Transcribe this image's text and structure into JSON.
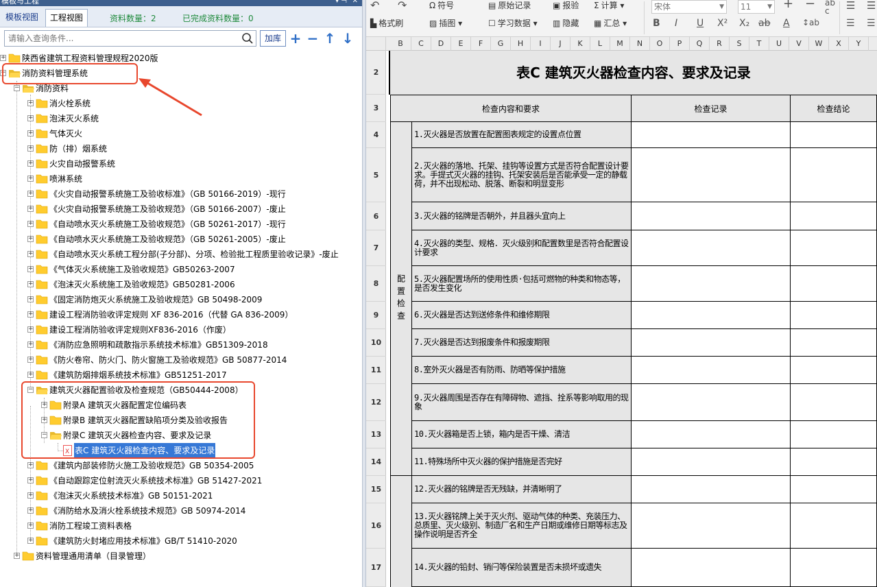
{
  "left_panel": {
    "title": "模板与工程",
    "tabs": [
      "模板视图",
      "工程视图"
    ],
    "count_label": "资料数量：2",
    "done_label": "已完成资料数量：0",
    "search_placeholder": "请输入查询条件...",
    "jiaku_label": "加库",
    "tree": [
      {
        "label": "陕西省建筑工程资料管理规程2020版"
      },
      {
        "label": "消防资料管理系统"
      },
      {
        "label": "消防资料"
      },
      {
        "label": "消火栓系统"
      },
      {
        "label": "泡沫灭火系统"
      },
      {
        "label": "气体灭火"
      },
      {
        "label": "防（排）烟系统"
      },
      {
        "label": "火灾自动报警系统"
      },
      {
        "label": "喷淋系统"
      },
      {
        "label": "《火灾自动报警系统施工及验收标准》（GB 50166-2019）-现行"
      },
      {
        "label": "《火灾自动报警系统施工及验收规范》（GB 50166-2007）-废止"
      },
      {
        "label": "《自动喷水灭火系统施工及验收规范》（GB 50261-2017）-现行"
      },
      {
        "label": "《自动喷水灭火系统施工及验收规范》（GB 50261-2005）-废止"
      },
      {
        "label": "《自动喷水灭火系统工程分部(子分部)、分项、检验批工程质里验收记录》-废止"
      },
      {
        "label": "《气体灭火系统施工及验收规范》GB50263-2007"
      },
      {
        "label": "《泡沫灭火系统施工及验收规范》GB50281-2006"
      },
      {
        "label": "《固定消防炮灭火系统施工及验收规范》GB 50498-2009"
      },
      {
        "label": "建设工程消防验收评定规则 XF 836-2016（代替 GA 836-2009）"
      },
      {
        "label": "建设工程消防验收评定规则XF836-2016（作废）"
      },
      {
        "label": "《消防应急照明和疏散指示系统技术标准》GB51309-2018"
      },
      {
        "label": "《防火卷帘、防火门、防火窗施工及验收规范》GB 50877-2014"
      },
      {
        "label": "《建筑防烟排烟系统技术标准》GB51251-2017"
      },
      {
        "label": "建筑灭火器配置验收及检查规范（GB50444-2008）"
      },
      {
        "label": "附录A 建筑灭火器配置定位编码表"
      },
      {
        "label": "附录B 建筑灭火器配置缺陷项分类及验收报告"
      },
      {
        "label": "附录C 建筑灭火器检查内容、要求及记录"
      },
      {
        "label": "表C 建筑灭火器检查内容、要求及记录"
      },
      {
        "label": "《建筑内部装修防火施工及验收规范》GB 50354-2005"
      },
      {
        "label": "《自动跟踪定位射流灭火系统技术标准》GB 51427-2021"
      },
      {
        "label": "《泡沫灭火系统技术标准》GB 50151-2021"
      },
      {
        "label": "《消防给水及消火栓系统技术规范》GB 50974-2014"
      },
      {
        "label": "消防工程竣工资料表格"
      },
      {
        "label": "《建筑防火封堵应用技术标准》GB/T 51410-2020"
      },
      {
        "label": "资料管理通用清单（目录管理）"
      }
    ]
  },
  "ribbon": {
    "symbol": "符号",
    "original_record": "原始记录",
    "report": "报验",
    "calc": "计算",
    "font_name": "宋体",
    "font_size": "11",
    "format_painter": "格式刷",
    "insert_image": "插图",
    "learn_data": "学习数据",
    "hide": "隐藏",
    "summary": "汇总"
  },
  "columns": [
    "B",
    "C",
    "D",
    "E",
    "F",
    "G",
    "H",
    "I",
    "J",
    "K",
    "L",
    "M",
    "N",
    "O",
    "P",
    "Q",
    "R",
    "S",
    "T",
    "U",
    "V",
    "W",
    "X",
    "Y"
  ],
  "rows": [
    "2",
    "3",
    "4",
    "5",
    "6",
    "7",
    "8",
    "9",
    "10",
    "11",
    "12",
    "13",
    "14",
    "15",
    "16",
    "17"
  ],
  "sheet": {
    "title": "表C  建筑灭火器检查内容、要求及记录",
    "header_content": "检查内容和要求",
    "header_record": "检查记录",
    "header_conclusion": "检查结论",
    "group1_label": "配置检查",
    "items": [
      "1.灭火器是否放置在配置图表规定的设置点位置",
      "2.灭火器的落地、托架、挂钩等设置方式是否符合配置设计要求。手提式灭火器的挂钩、托架安装后是否能承受一定的静载荷，并不出现松动、脱落、断裂和明显变形",
      "3.灭火器的铭牌是否朝外，并且器头宜向上",
      "4.灭火器的类型、规格．灭火级别和配置数里是否符合配置设计要求",
      "5.灭火器配置场所的使用性质·包括可燃物的种类和物态等，是否发生变化",
      "6.灭火器是否达到送修条件和维修期限",
      "7.灭火器是否达到报废条件和报废期限",
      "8.室外灭火器是否有防雨、防晒等保护措施",
      "9.灭火器周围是否存在有障碍物、遮挡、拴系等影响取用的现象",
      "10.灭火器箱是否上锁，箱内是否干燥、清洁",
      "11.特殊场所中灭火器的保护措施是否完好",
      "12.灭火器的铭牌是否无残缺，并清晰明了",
      "13.灭火器铭牌上关于灭火剂、驱动气体的种类、充装压力、总质里、灭火级别、制造厂名和生产日期或维修日期等标志及操作说明是否齐全",
      "14.灭火器的铅封、销闩等保险装置是否未损坏或遗失"
    ]
  },
  "colors": {
    "accent": "#3678d6",
    "annotation": "#e8472d",
    "count_green": "#1f8a3c"
  }
}
